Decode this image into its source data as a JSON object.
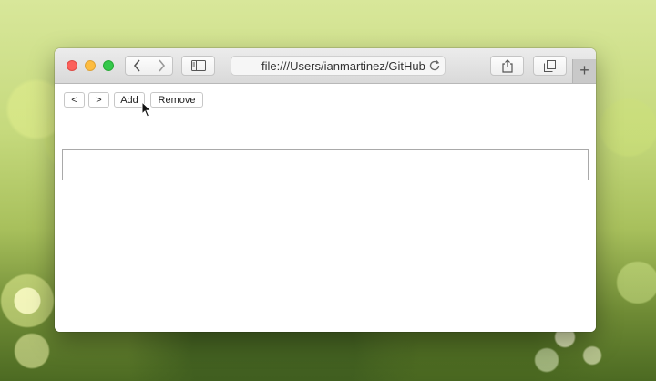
{
  "browser": {
    "address_url": "file:///Users/ianmartinez/GitHub",
    "newtab_label": "+",
    "icons": [
      "back-chevron-icon",
      "forward-chevron-icon",
      "sidebar-icon",
      "reload-icon",
      "share-icon",
      "tabs-icon",
      "mouse-pointer-icon"
    ]
  },
  "page": {
    "buttons": {
      "prev_label": "<",
      "next_label": ">",
      "add_label": "Add",
      "remove_label": "Remove"
    },
    "text_field": {
      "value": ""
    }
  },
  "colors": {
    "close": "#fc605b",
    "minimize": "#fdbc40",
    "zoom": "#34c84a"
  }
}
